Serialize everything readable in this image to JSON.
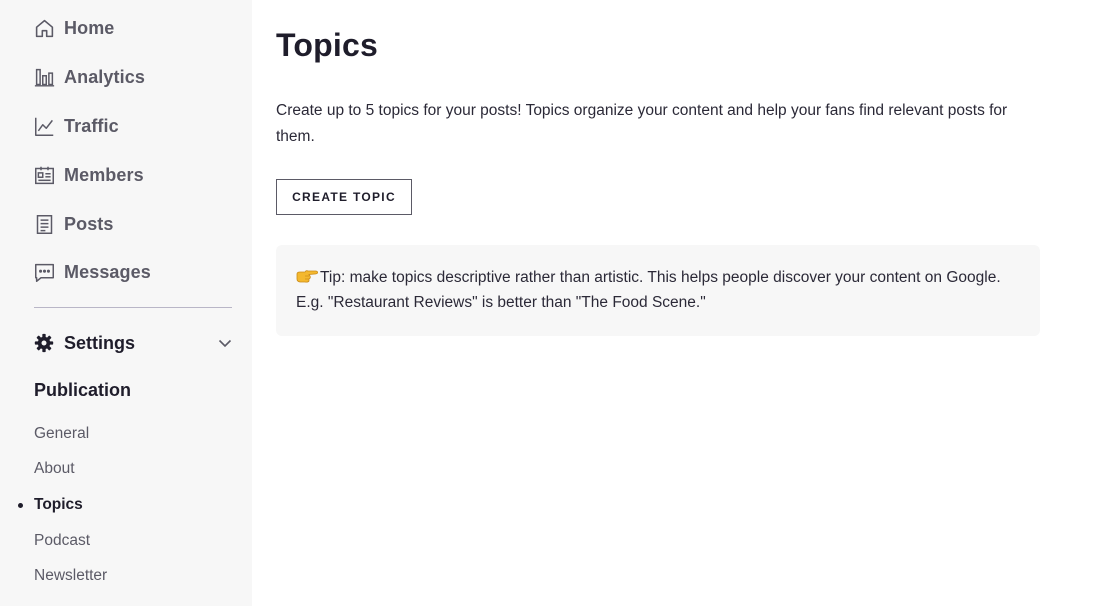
{
  "sidebar": {
    "nav": [
      {
        "id": "home",
        "label": "Home",
        "icon": "home-icon"
      },
      {
        "id": "analytics",
        "label": "Analytics",
        "icon": "bar-chart-icon"
      },
      {
        "id": "traffic",
        "label": "Traffic",
        "icon": "line-chart-icon"
      },
      {
        "id": "members",
        "label": "Members",
        "icon": "id-card-icon"
      },
      {
        "id": "posts",
        "label": "Posts",
        "icon": "document-icon"
      },
      {
        "id": "messages",
        "label": "Messages",
        "icon": "chat-bubble-icon"
      }
    ],
    "settings": {
      "label": "Settings",
      "icon": "gear-icon",
      "expand_icon": "chevron-down-icon"
    },
    "section_title": "Publication",
    "sub_items": [
      {
        "label": "General",
        "active": false
      },
      {
        "label": "About",
        "active": false
      },
      {
        "label": "Topics",
        "active": true
      },
      {
        "label": "Podcast",
        "active": false
      },
      {
        "label": "Newsletter",
        "active": false
      }
    ]
  },
  "main": {
    "title": "Topics",
    "description": "Create up to 5 topics for your posts! Topics organize your content and help your fans find relevant posts for them.",
    "create_button_label": "CREATE TOPIC",
    "tip": {
      "icon": "pointing-hand-emoji",
      "text": "Tip: make topics descriptive rather than artistic. This helps people discover your content on Google. E.g. \"Restaurant Reviews\" is better than \"The Food Scene.\""
    }
  },
  "colors": {
    "sidebar_bg": "#f7f7f7",
    "text_primary": "#1f1d2b",
    "text_muted": "#5b5a66",
    "divider": "#b9b6c7",
    "tip_bg": "#f7f7f7"
  }
}
